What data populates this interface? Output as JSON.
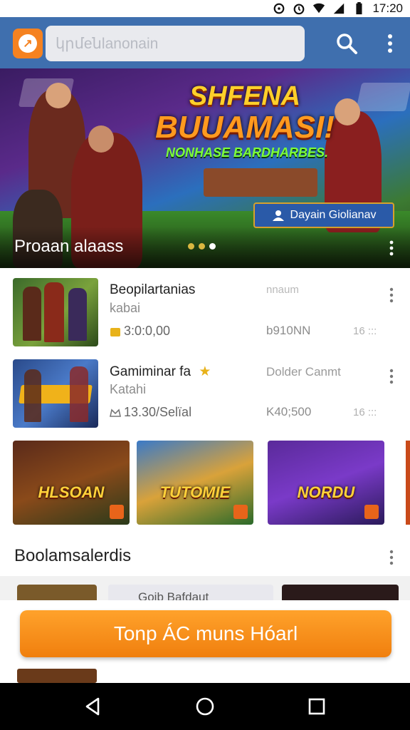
{
  "status_bar": {
    "time": "17:20"
  },
  "app_bar": {
    "search_text": "կրմeնlanonain",
    "logo_icon": "brand-logo-icon",
    "search_icon": "search-icon",
    "overflow_icon": "more-vert-icon"
  },
  "hero": {
    "title_line1": "SHFENA",
    "title_line2": "BUUAMASI!",
    "subtitle": "NONHASE BARDHARBES.",
    "cta_label": "Dayain Giolianav",
    "caption": "Proaan alaass",
    "slides_total": 3,
    "active_slide": 3,
    "accent_color": "#ffd02a"
  },
  "list": [
    {
      "title": "Beopilartanias",
      "subtitle": "kabai",
      "price": "3:0:0,00",
      "meta_top": "nnaum",
      "meta_mid": "b910NN",
      "meta_right": "16 :::"
    },
    {
      "title": "Gamiminar fa",
      "subtitle": "Katahi",
      "price": "13.30/Selïal",
      "meta_top": "Dolder Canmt",
      "meta_mid": "K40;500",
      "meta_right": "16 :::"
    }
  ],
  "cards": [
    {
      "label": "HLSOAN"
    },
    {
      "label": "TUTOMIE"
    },
    {
      "label": "NORDU"
    }
  ],
  "section": {
    "title": "Boolamsalerdis"
  },
  "peek": {
    "text": "Goib Bafdaut"
  },
  "action_button": {
    "label": "Tonp ÁC muns Hóarl",
    "color": "#f58a12"
  },
  "nav": {
    "back_icon": "back-icon",
    "home_icon": "home-icon",
    "recents_icon": "recents-icon"
  }
}
